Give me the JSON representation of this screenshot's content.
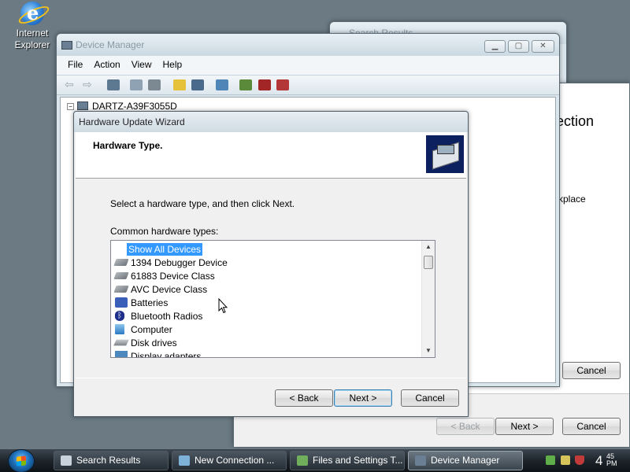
{
  "desktop": {
    "ie_label_line1": "Internet",
    "ie_label_line2": "Explorer"
  },
  "search_window": {
    "title": "Search Results"
  },
  "connection_window": {
    "heading_fragment": "ection",
    "text_fragment": "kplace",
    "cancel_top": "Cancel",
    "back_button": "< Back",
    "next_button": "Next >",
    "cancel_button": "Cancel"
  },
  "device_manager": {
    "title": "Device Manager",
    "menu": [
      "File",
      "Action",
      "View",
      "Help"
    ],
    "tree_root": "DARTZ-A39F3055D",
    "toolbar_icons": [
      "back-arrow-icon",
      "forward-arrow-icon",
      "show-hide-tree-icon",
      "properties-icon",
      "print-icon",
      "help-icon",
      "help-topics-icon",
      "scan-hardware-icon",
      "update-driver-icon",
      "disable-device-icon",
      "uninstall-device-icon"
    ]
  },
  "wizard": {
    "title": "Hardware Update Wizard",
    "heading": "Hardware Type.",
    "instruction": "Select a hardware type, and then click Next.",
    "list_label": "Common hardware types:",
    "items": [
      {
        "label": "Show All Devices",
        "icon": "none",
        "selected": true
      },
      {
        "label": "1394 Debugger Device",
        "icon": "device-icon"
      },
      {
        "label": "61883 Device Class",
        "icon": "device-icon"
      },
      {
        "label": "AVC Device Class",
        "icon": "device-icon"
      },
      {
        "label": "Batteries",
        "icon": "battery-icon"
      },
      {
        "label": "Bluetooth Radios",
        "icon": "bluetooth-icon"
      },
      {
        "label": "Computer",
        "icon": "computer-icon"
      },
      {
        "label": "Disk drives",
        "icon": "disk-drive-icon"
      },
      {
        "label": "Display adapters",
        "icon": "display-adapter-icon"
      }
    ],
    "back_button": "< Back",
    "next_button": "Next >",
    "cancel_button": "Cancel"
  },
  "taskbar": {
    "tasks": [
      {
        "label": "Search Results",
        "active": false
      },
      {
        "label": "New Connection ...",
        "active": false
      },
      {
        "label": "Files and Settings T...",
        "active": false
      },
      {
        "label": "Device Manager",
        "active": true
      }
    ],
    "clock_hour": "4",
    "clock_minutes": "45",
    "clock_ampm": "PM"
  },
  "colors": {
    "selection": "#3399ff",
    "desktop": "#6b7a83",
    "taskbar": "#1d242a"
  }
}
